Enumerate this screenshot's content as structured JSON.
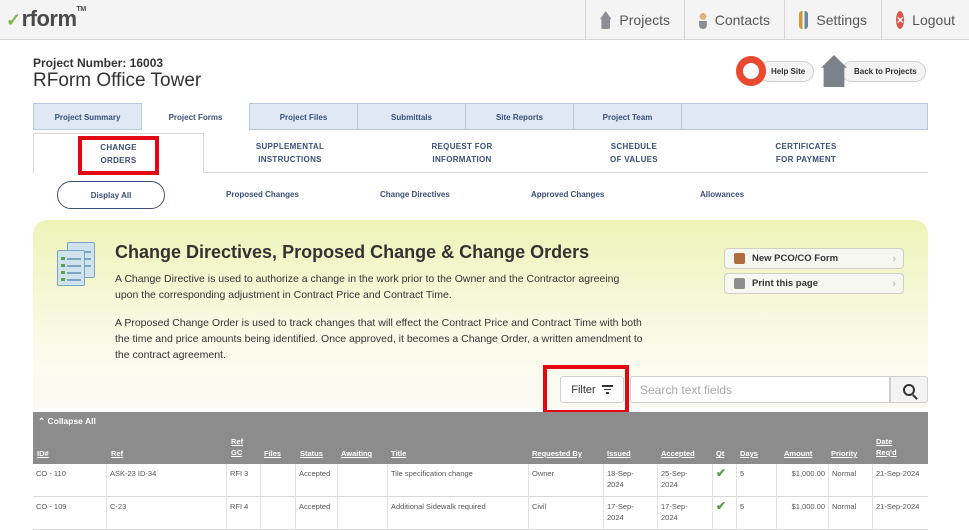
{
  "brand": {
    "logo_text": "rform",
    "logo_mark": "TM"
  },
  "topnav": {
    "items": [
      {
        "label": "Projects",
        "icon": "house-icon"
      },
      {
        "label": "Contacts",
        "icon": "person-icon"
      },
      {
        "label": "Settings",
        "icon": "tools-icon"
      },
      {
        "label": "Logout",
        "icon": "logout-icon"
      }
    ]
  },
  "project": {
    "number_label": "Project Number: 16003",
    "name": "RForm Office Tower"
  },
  "header_links": {
    "help_site": "Help Site",
    "back_to_projects": "Back to Projects"
  },
  "tabs": [
    "Project Summary",
    "Project Forms",
    "Project Files",
    "Submittals",
    "Site Reports",
    "Project Team"
  ],
  "subtabs": [
    {
      "line1": "CHANGE",
      "line2": "ORDERS"
    },
    {
      "line1": "SUPPLEMENTAL",
      "line2": "INSTRUCTIONS"
    },
    {
      "line1": "REQUEST FOR",
      "line2": "INFORMATION"
    },
    {
      "line1": "SCHEDULE",
      "line2": "OF VALUES"
    },
    {
      "line1": "CERTIFICATES",
      "line2": "FOR PAYMENT"
    }
  ],
  "views": {
    "display_all": "Display All",
    "links": [
      "Proposed Changes",
      "Change Directives",
      "Approved Changes",
      "Allowances"
    ]
  },
  "panel": {
    "title": "Change Directives, Proposed Change & Change Orders",
    "p1": "A Change Directive is used to authorize a change in the work prior to the Owner and the Contractor agreeing upon the corresponding adjustment in Contract Price and Contract Time.",
    "p2": "A Proposed Change Order is used to track changes that will effect the Contract Price and Contract Time with both the time and price amounts being identified. Once approved, it becomes a Change Order, a written amendment to the contract agreement.",
    "new_btn": "New PCO/CO Form",
    "print_btn": "Print this page"
  },
  "filter": {
    "label": "Filter",
    "search_placeholder": "Search text fields"
  },
  "table": {
    "collapse_label": "Collapse All",
    "headers": {
      "id": "ID#",
      "ref": "Ref",
      "ref_gc_1": "Ref",
      "ref_gc_2": "GC",
      "files": "Files",
      "status": "Status",
      "awaiting": "Awaiting",
      "title": "Title",
      "requested_by": "Requested By",
      "issued": "Issued",
      "accepted": "Accepted",
      "qt": "Qt",
      "days": "Days",
      "amount": "Amount",
      "priority": "Priority",
      "date_req_1": "Date",
      "date_req_2": "Req'd"
    },
    "rows": [
      {
        "id": "CO - 110",
        "ref": "ASK-23 ID-34",
        "ref_gc": "RFI 3",
        "status": "Accepted",
        "title": "Tile specification change",
        "requested_by": "Owner",
        "issued_1": "18-Sep-",
        "issued_2": "2024",
        "accepted_1": "25-Sep-",
        "accepted_2": "2024",
        "qt": "✔",
        "days": "5",
        "amount": "$1,000.00",
        "priority": "Normal",
        "date_req": "21-Sep-2024"
      },
      {
        "id": "CO - 109",
        "ref": "C-23",
        "ref_gc": "RFI 4",
        "status": "Accepted",
        "title": "Additional Sidewalk required",
        "requested_by": "Civil",
        "issued_1": "17-Sep-",
        "issued_2": "2024",
        "accepted_1": "17-Sep-",
        "accepted_2": "2024",
        "qt": "✔",
        "days": "5",
        "amount": "$1,000.00",
        "priority": "Normal",
        "date_req": "21-Sep-2024"
      }
    ]
  },
  "colors": {
    "accent": "#3a4f7a",
    "highlight": "#e30613",
    "panel": "#eef3b8",
    "table_head": "#8c8c8c",
    "check": "#5aa245"
  }
}
